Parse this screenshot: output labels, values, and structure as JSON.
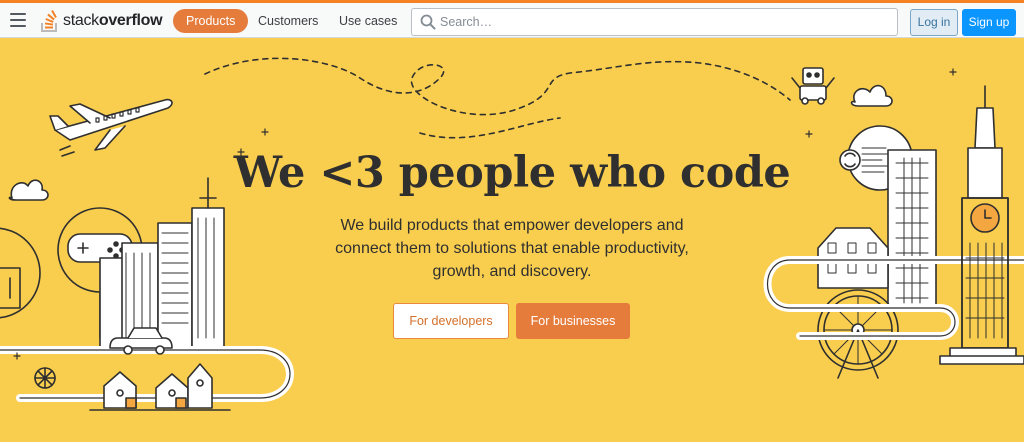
{
  "header": {
    "logo": {
      "prefix": "stack",
      "bold": "overflow"
    },
    "nav": [
      {
        "label": "Products",
        "active": true
      },
      {
        "label": "Customers",
        "active": false
      },
      {
        "label": "Use cases",
        "active": false
      }
    ],
    "search": {
      "placeholder": "Search…",
      "value": ""
    },
    "login_label": "Log in",
    "signup_label": "Sign up"
  },
  "hero": {
    "title": "We <3 people who code",
    "subtitle": "We build products that empower developers and connect them to solutions that enable productivity, growth, and discovery.",
    "cta_developers": "For developers",
    "cta_businesses": "For businesses"
  },
  "colors": {
    "brand_orange": "#f48225",
    "hero_background": "#f9ce4f",
    "active_pill": "#e57c3c",
    "signup_blue": "#0a95ff",
    "login_bg": "#e1ecf4",
    "line_art": "#2f2f2f",
    "art_fill": "#ffffff",
    "art_accent": "#f4a640"
  },
  "icons": [
    "hamburger-icon",
    "stackoverflow-logo-icon",
    "search-icon"
  ]
}
